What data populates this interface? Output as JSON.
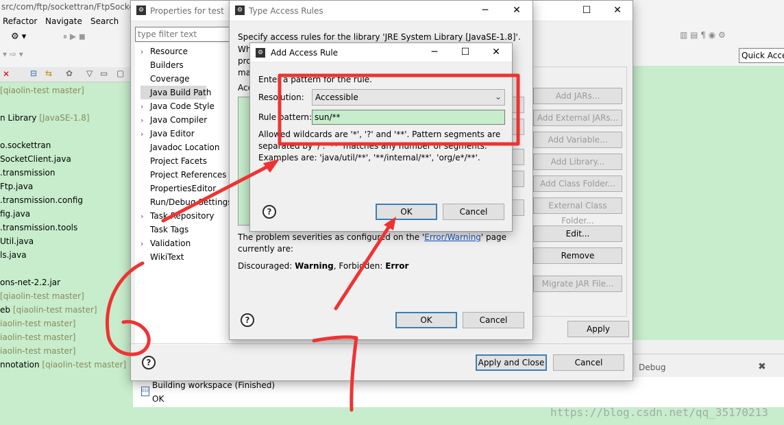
{
  "ide": {
    "path_text": "src/com/ftp/sockettran/FtpSocke",
    "menu": [
      "Refactor",
      "Navigate",
      "Search"
    ],
    "tree": [
      {
        "text": " [qiaolin-test master]",
        "git": true
      },
      {
        "text": "n Library ",
        "suffix": "[JavaSE-1.8]"
      },
      {
        "text": "o.sockettran"
      },
      {
        "text": "SocketClient.java"
      },
      {
        "text": ".transmission"
      },
      {
        "text": "Ftp.java"
      },
      {
        "text": ".transmission.config"
      },
      {
        "text": "fig.java"
      },
      {
        "text": ".transmission.tools"
      },
      {
        "text": "Util.java"
      },
      {
        "text": "ls.java"
      },
      {
        "text": "ons-net-2.2.jar"
      },
      {
        "text": " [qiaolin-test master]",
        "git": true
      },
      {
        "text": "eb ",
        "suffix": "[qiaolin-test master]"
      },
      {
        "text": "iaolin-test master]",
        "git": true
      },
      {
        "text": "iaolin-test master]",
        "git": true
      },
      {
        "text": "iaolin-test master]",
        "git": true
      },
      {
        "text": "nnotation ",
        "suffix": "[qiaolin-test master]"
      }
    ],
    "quick_access": "Quick Acce",
    "debug_tab": "Debug",
    "console": {
      "line1": "Building workspace (Finished)",
      "line2": "OK"
    },
    "watermark": "https://blog.csdn.net/qq_35170213"
  },
  "properties": {
    "title": "Properties for test",
    "filter_placeholder": "type filter text",
    "items": [
      {
        "label": "Resource",
        "expand": true
      },
      {
        "label": "Builders",
        "expand": false
      },
      {
        "label": "Coverage",
        "expand": false
      },
      {
        "label": "Java Build Path",
        "expand": false,
        "selected": true
      },
      {
        "label": "Java Code Style",
        "expand": true
      },
      {
        "label": "Java Compiler",
        "expand": true
      },
      {
        "label": "Java Editor",
        "expand": true
      },
      {
        "label": "Javadoc Location",
        "expand": false
      },
      {
        "label": "Project Facets",
        "expand": false
      },
      {
        "label": "Project References",
        "expand": false
      },
      {
        "label": "PropertiesEditor",
        "expand": false
      },
      {
        "label": "Run/Debug Settings",
        "expand": false
      },
      {
        "label": "Task Repository",
        "expand": true
      },
      {
        "label": "Task Tags",
        "expand": false
      },
      {
        "label": "Validation",
        "expand": true
      },
      {
        "label": "WikiText",
        "expand": false
      }
    ],
    "side_buttons": [
      "Add JARs...",
      "Add External JARs...",
      "Add Variable...",
      "Add Library...",
      "Add Class Folder...",
      "External Class Folder...",
      "Edit...",
      "Remove",
      "Migrate JAR File..."
    ],
    "apply": "Apply",
    "apply_close": "Apply and Close",
    "cancel": "Cancel"
  },
  "type_rules": {
    "title": "Type Access Rules",
    "desc": "Specify access rules for the library 'JRE System Library [JavaSE-1.8]'.",
    "desc_frag": [
      "Wh",
      "pro",
      "ma"
    ],
    "acc_frag": "Acc",
    "problem_line1": "The problem severities as configured on the '",
    "problem_link": "Error/Warning",
    "problem_line1_end": "' page",
    "problem_line2": "currently are:",
    "discouraged_label": "Discouraged: ",
    "discouraged_value": "Warning",
    "forbidden_label": ", Forbidden: ",
    "forbidden_value": "Error",
    "ok": "OK",
    "cancel": "Cancel"
  },
  "add_rule": {
    "title": "Add Access Rule",
    "prompt": "Enter a pattern for the rule.",
    "resolution_label": "Resolution:",
    "resolution_value": "Accessible",
    "pattern_label": "Rule pattern:",
    "pattern_value": "sun/**",
    "help1": "Allowed wildcards are '*', '?' and '**'. Pattern segments are",
    "help2": "separated by '/'. '**' matches any number of segments.",
    "help3": "Examples are: 'java/util/**', '**/internal/**', 'org/e*/**'.",
    "ok": "OK",
    "cancel": "Cancel"
  },
  "annotations": {
    "six": "6",
    "seven": "7"
  },
  "colors": {
    "annotation_red": "#ee3333",
    "ide_green": "#c7edcc",
    "link": "#1a55c8"
  }
}
